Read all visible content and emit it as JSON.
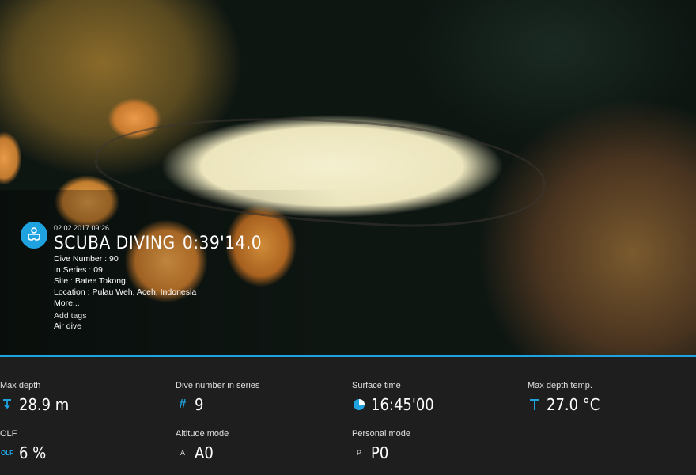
{
  "dive": {
    "date": "02.02.2017 09:26",
    "title": "SCUBA DIVING",
    "duration": "0:39'14.0",
    "dive_number": "Dive Number : 90",
    "in_series": "In Series : 09",
    "site": "Site : Batee Tokong",
    "location": "Location : Pulau Weh, Aceh, Indonesia",
    "more": "More...",
    "add_tags": "Add tags",
    "tag": "Air dive"
  },
  "stats": [
    {
      "label": "Max depth",
      "value": "28.9 m",
      "icon": "depth-arrow-icon"
    },
    {
      "label": "Dive number in series",
      "value": "9",
      "icon": "hash-icon"
    },
    {
      "label": "Surface time",
      "value": "16:45'00",
      "icon": "clock-pie-icon"
    },
    {
      "label": "Max depth temp.",
      "value": "27.0 °C",
      "icon": "thermometer-depth-icon"
    },
    {
      "label": "OLF",
      "value": "6 %",
      "icon": "olf-icon",
      "icon_text": "OLF"
    },
    {
      "label": "Altitude mode",
      "value": "A0",
      "icon": "altitude-letter-icon",
      "icon_text": "A"
    },
    {
      "label": "Personal mode",
      "value": "P0",
      "icon": "personal-letter-icon",
      "icon_text": "P"
    }
  ],
  "colors": {
    "accent": "#1fa3e0",
    "panel": "#1e1e1e"
  }
}
